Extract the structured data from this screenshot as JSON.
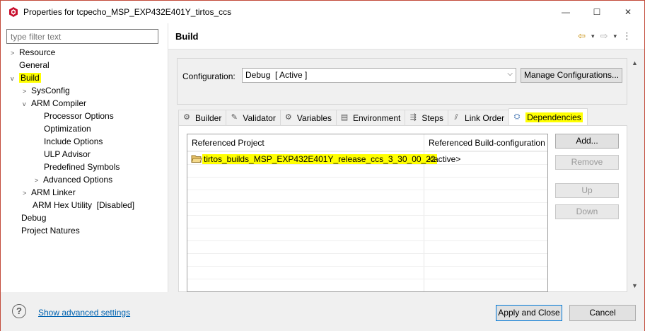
{
  "window": {
    "title": "Properties for tcpecho_MSP_EXP432E401Y_tirtos_ccs",
    "controls": {
      "minimize": "—",
      "maximize": "☐",
      "close": "✕"
    }
  },
  "sidebar": {
    "filter_placeholder": "type filter text",
    "items": [
      {
        "label": "Resource",
        "twisty": ">"
      },
      {
        "label": "General",
        "twisty": ""
      },
      {
        "label": "Build",
        "twisty": "v",
        "highlighted": true
      },
      {
        "label": "SysConfig",
        "twisty": ">"
      },
      {
        "label": "ARM Compiler",
        "twisty": "v"
      },
      {
        "label": "Processor Options",
        "twisty": ""
      },
      {
        "label": "Optimization",
        "twisty": ""
      },
      {
        "label": "Include Options",
        "twisty": ""
      },
      {
        "label": "ULP Advisor",
        "twisty": ""
      },
      {
        "label": "Predefined Symbols",
        "twisty": ""
      },
      {
        "label": "Advanced Options",
        "twisty": ">"
      },
      {
        "label": "ARM Linker",
        "twisty": ">"
      },
      {
        "label": "ARM Hex Utility  [Disabled]",
        "twisty": ""
      },
      {
        "label": "Debug",
        "twisty": ""
      },
      {
        "label": "Project Natures",
        "twisty": ""
      }
    ]
  },
  "main": {
    "title": "Build",
    "configuration_label": "Configuration:",
    "configuration_value": "Debug  [ Active ]",
    "manage_button": "Manage Configurations...",
    "tabs": [
      {
        "label": "Builder",
        "icon": "builder-icon"
      },
      {
        "label": "Validator",
        "icon": "validator-icon"
      },
      {
        "label": "Variables",
        "icon": "variables-icon"
      },
      {
        "label": "Environment",
        "icon": "environment-icon"
      },
      {
        "label": "Steps",
        "icon": "steps-icon"
      },
      {
        "label": "Link Order",
        "icon": "link-order-icon"
      },
      {
        "label": "Dependencies",
        "icon": "dependencies-icon",
        "active": true,
        "highlighted": true
      }
    ],
    "table": {
      "headers": [
        "Referenced Project",
        "Referenced Build-configuration"
      ],
      "rows": [
        {
          "project": "tirtos_builds_MSP_EXP432E401Y_release_ccs_3_30_00_22",
          "config": "<active>"
        }
      ]
    },
    "buttons": {
      "add": "Add...",
      "remove": "Remove",
      "up": "Up",
      "down": "Down"
    }
  },
  "footer": {
    "advanced_link": "Show advanced settings",
    "apply_close": "Apply and Close",
    "cancel": "Cancel"
  },
  "colors": {
    "highlight": "#ffff00",
    "link": "#0063b1",
    "accent": "#0078d7"
  }
}
